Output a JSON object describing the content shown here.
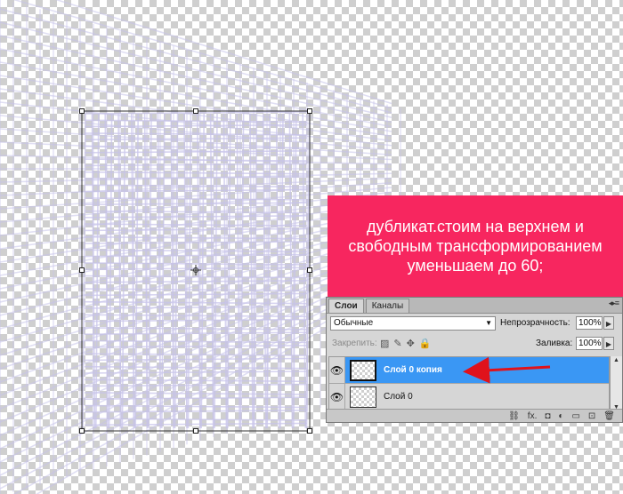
{
  "callout": {
    "text": "дубликат.стоим на верхнем и свободным трансформированием уменьшаем до 60;",
    "bg_color": "#f7265f"
  },
  "layers_panel": {
    "tabs": [
      {
        "label": "Слои",
        "active": true
      },
      {
        "label": "Каналы",
        "active": false
      }
    ],
    "menu_icon": "panel-menu-icon",
    "blend_mode": "Обычные",
    "opacity_label": "Непрозрачность:",
    "opacity_value": "100%",
    "lock_label": "Закрепить:",
    "fill_label": "Заливка:",
    "fill_value": "100%",
    "layers": [
      {
        "name": "Слой 0 копия",
        "selected": true,
        "visible": true
      },
      {
        "name": "Слой 0",
        "selected": false,
        "visible": true
      }
    ],
    "footer_icons": [
      "link-icon",
      "fx-icon",
      "mask-icon",
      "adjustment-icon",
      "group-icon",
      "new-layer-icon",
      "trash-icon"
    ],
    "footer_glyphs": [
      "⛓",
      "fx.",
      "◘",
      "◐",
      "▭",
      "⊡",
      "🗑"
    ]
  },
  "colors": {
    "selection": "#3a97f4",
    "arrow": "#e0121b",
    "grid_lines": "#b9b6e0"
  }
}
